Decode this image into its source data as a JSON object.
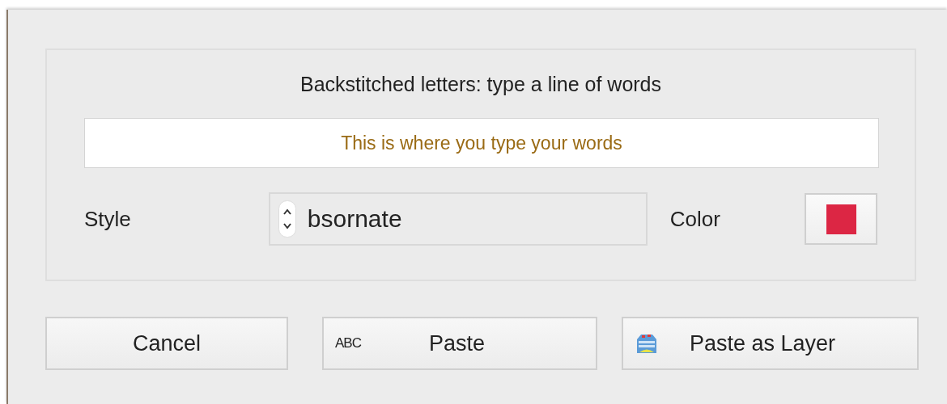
{
  "dialog": {
    "heading": "Backstitched letters: type a line of words",
    "text_field": {
      "placeholder": "This is where you type your words"
    },
    "style": {
      "label": "Style",
      "value": "bsornate"
    },
    "color": {
      "label": "Color",
      "color": "#dc2644"
    },
    "buttons": [
      {
        "kind": "plain",
        "label": "Cancel"
      },
      {
        "kind": "text-icon",
        "label": "Paste",
        "icon_text": "ABC"
      },
      {
        "kind": "layer-icon",
        "label": "Paste as Layer"
      }
    ]
  }
}
